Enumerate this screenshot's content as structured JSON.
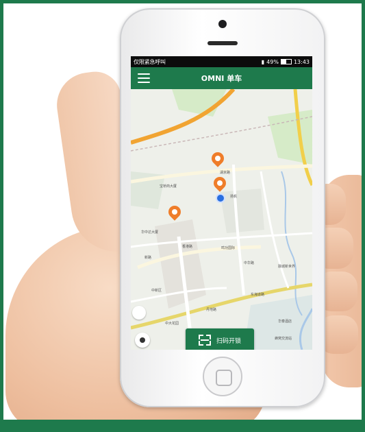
{
  "statusbar": {
    "left": "仅限紧急呼叫",
    "battery": "49%",
    "battery_level": 0.49,
    "time": "13:43"
  },
  "appbar": {
    "title": "OMNI 单车",
    "menu_icon": "hamburger-menu-icon"
  },
  "map": {
    "labels": [
      "宝桥商大厦",
      "湖京路",
      "华中达大厦",
      "香港路",
      "鸣功国际",
      "新路",
      "中华路",
      "丹地路",
      "中大花园",
      "中新区",
      "融城新世界",
      "华泰酒店",
      "扬帆",
      "东海道路",
      "蜂窝交流站"
    ],
    "scan_button": {
      "label": "扫码开锁",
      "icon": "scan-icon"
    },
    "locate_icon": "locate-icon"
  },
  "colors": {
    "brand_green": "#1e7a4c",
    "pin_orange": "#ef7d2a",
    "user_blue": "#2a6fe0"
  }
}
